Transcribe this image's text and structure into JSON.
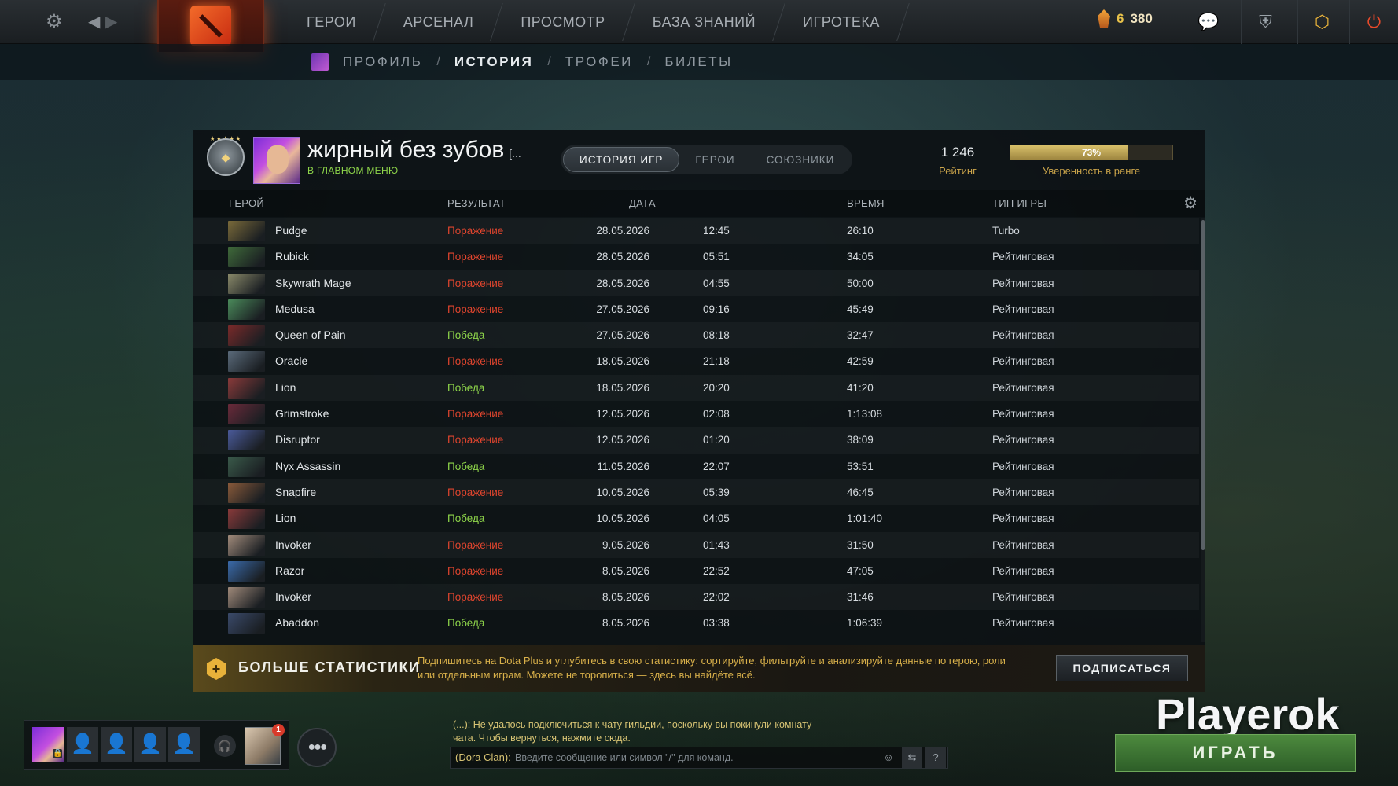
{
  "topnav": {
    "items": [
      "ГЕРОИ",
      "АРСЕНАЛ",
      "ПРОСМОТР",
      "БАЗА ЗНАНИЙ",
      "ИГРОТЕКА"
    ],
    "shards_a": "6",
    "shards_b": "380"
  },
  "subnav": {
    "items": [
      "ПРОФИЛЬ",
      "ИСТОРИЯ",
      "ТРОФЕИ",
      "БИЛЕТЫ"
    ],
    "separator": "/"
  },
  "profile": {
    "name": "жирный без зубов",
    "name_suffix": "[...",
    "status": "В ГЛАВНОМ МЕНЮ",
    "tabs": [
      "ИСТОРИЯ ИГР",
      "ГЕРОИ",
      "СОЮЗНИКИ"
    ],
    "rating": "1 246",
    "rating_label": "Рейтинг",
    "confidence": 73,
    "confidence_text": "73%",
    "confidence_label": "Уверенность в ранге"
  },
  "table": {
    "headers": [
      "ГЕРОЙ",
      "РЕЗУЛЬТАТ",
      "ДАТА",
      "ВРЕМЯ",
      "ТИП ИГРЫ"
    ],
    "rows": [
      {
        "hero": "Pudge",
        "result": "Поражение",
        "win": false,
        "date": "28.05.2026",
        "time": "12:45",
        "duration": "26:10",
        "mode": "Turbo",
        "color": "#7a6a3a"
      },
      {
        "hero": "Rubick",
        "result": "Поражение",
        "win": false,
        "date": "28.05.2026",
        "time": "05:51",
        "duration": "34:05",
        "mode": "Рейтинговая",
        "color": "#3f6a3a"
      },
      {
        "hero": "Skywrath Mage",
        "result": "Поражение",
        "win": false,
        "date": "28.05.2026",
        "time": "04:55",
        "duration": "50:00",
        "mode": "Рейтинговая",
        "color": "#8a8a6a"
      },
      {
        "hero": "Medusa",
        "result": "Поражение",
        "win": false,
        "date": "27.05.2026",
        "time": "09:16",
        "duration": "45:49",
        "mode": "Рейтинговая",
        "color": "#4a8a5a"
      },
      {
        "hero": "Queen of Pain",
        "result": "Победа",
        "win": true,
        "date": "27.05.2026",
        "time": "08:18",
        "duration": "32:47",
        "mode": "Рейтинговая",
        "color": "#7a2a2a"
      },
      {
        "hero": "Oracle",
        "result": "Поражение",
        "win": false,
        "date": "18.05.2026",
        "time": "21:18",
        "duration": "42:59",
        "mode": "Рейтинговая",
        "color": "#5a6a7a"
      },
      {
        "hero": "Lion",
        "result": "Победа",
        "win": true,
        "date": "18.05.2026",
        "time": "20:20",
        "duration": "41:20",
        "mode": "Рейтинговая",
        "color": "#8a3a3a"
      },
      {
        "hero": "Grimstroke",
        "result": "Поражение",
        "win": false,
        "date": "12.05.2026",
        "time": "02:08",
        "duration": "1:13:08",
        "mode": "Рейтинговая",
        "color": "#6a2a3a"
      },
      {
        "hero": "Disruptor",
        "result": "Поражение",
        "win": false,
        "date": "12.05.2026",
        "time": "01:20",
        "duration": "38:09",
        "mode": "Рейтинговая",
        "color": "#4a5a9a"
      },
      {
        "hero": "Nyx Assassin",
        "result": "Победа",
        "win": true,
        "date": "11.05.2026",
        "time": "22:07",
        "duration": "53:51",
        "mode": "Рейтинговая",
        "color": "#3a5a4a"
      },
      {
        "hero": "Snapfire",
        "result": "Поражение",
        "win": false,
        "date": "10.05.2026",
        "time": "05:39",
        "duration": "46:45",
        "mode": "Рейтинговая",
        "color": "#8a5a3a"
      },
      {
        "hero": "Lion",
        "result": "Победа",
        "win": true,
        "date": "10.05.2026",
        "time": "04:05",
        "duration": "1:01:40",
        "mode": "Рейтинговая",
        "color": "#8a3a3a"
      },
      {
        "hero": "Invoker",
        "result": "Поражение",
        "win": false,
        "date": "9.05.2026",
        "time": "01:43",
        "duration": "31:50",
        "mode": "Рейтинговая",
        "color": "#a08a7a"
      },
      {
        "hero": "Razor",
        "result": "Поражение",
        "win": false,
        "date": "8.05.2026",
        "time": "22:52",
        "duration": "47:05",
        "mode": "Рейтинговая",
        "color": "#3a6aaa"
      },
      {
        "hero": "Invoker",
        "result": "Поражение",
        "win": false,
        "date": "8.05.2026",
        "time": "22:02",
        "duration": "31:46",
        "mode": "Рейтинговая",
        "color": "#a08a7a"
      },
      {
        "hero": "Abaddon",
        "result": "Победа",
        "win": true,
        "date": "8.05.2026",
        "time": "03:38",
        "duration": "1:06:39",
        "mode": "Рейтинговая",
        "color": "#3a4a6a"
      }
    ]
  },
  "plus": {
    "title": "БОЛЬШЕ СТАТИСТИКИ",
    "text": "Подпишитесь на Dota Plus и углубитесь в свою статистику: сортируйте, фильтруйте и анализируйте данные по герою, роли или отдельным играм. Можете не торопиться — здесь вы найдёте всё.",
    "button": "ПОДПИСАТЬСЯ"
  },
  "party": {
    "friend_badge": "1"
  },
  "chat": {
    "message": "(...): Не удалось подключиться к чату гильдии, поскольку вы покинули комнату чата. Чтобы вернуться, нажмите сюда.",
    "channel": "(Dora Clan):",
    "placeholder": "Введите сообщение или символ \"/\" для команд.",
    "help": "?"
  },
  "brand": "Playerok",
  "play_button": "ИГРАТЬ",
  "icons": {
    "settings": "gear-icon",
    "back": "arrow-left-icon",
    "forward": "arrow-right-icon"
  }
}
